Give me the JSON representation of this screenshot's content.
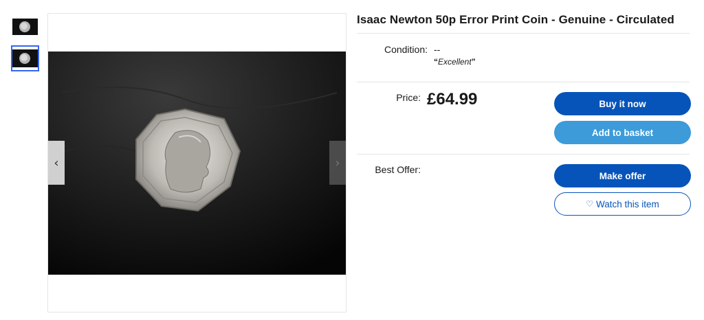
{
  "thumbnails": [
    {
      "icon": "coin-thumbnail-icon"
    },
    {
      "icon": "coin-thumbnail-icon",
      "selected": true
    }
  ],
  "gallery": {
    "prev_icon": "‹",
    "next_icon": "›",
    "image_icon": "fifty-pence-coin-photo"
  },
  "listing": {
    "title": "Isaac Newton 50p Error Print Coin - Genuine - Circulated",
    "condition_label": "Condition:",
    "condition_value": "--",
    "condition_note": "Excellent",
    "price_label": "Price:",
    "price_value": "£64.99",
    "best_offer_label": "Best Offer:"
  },
  "actions": {
    "buy_now": "Buy it now",
    "add_to_basket": "Add to basket",
    "make_offer": "Make offer",
    "watch": "Watch this item"
  },
  "colors": {
    "primary_blue": "#0654ba",
    "secondary_blue": "#3d9bd9",
    "selected_outline": "#3665f3"
  }
}
